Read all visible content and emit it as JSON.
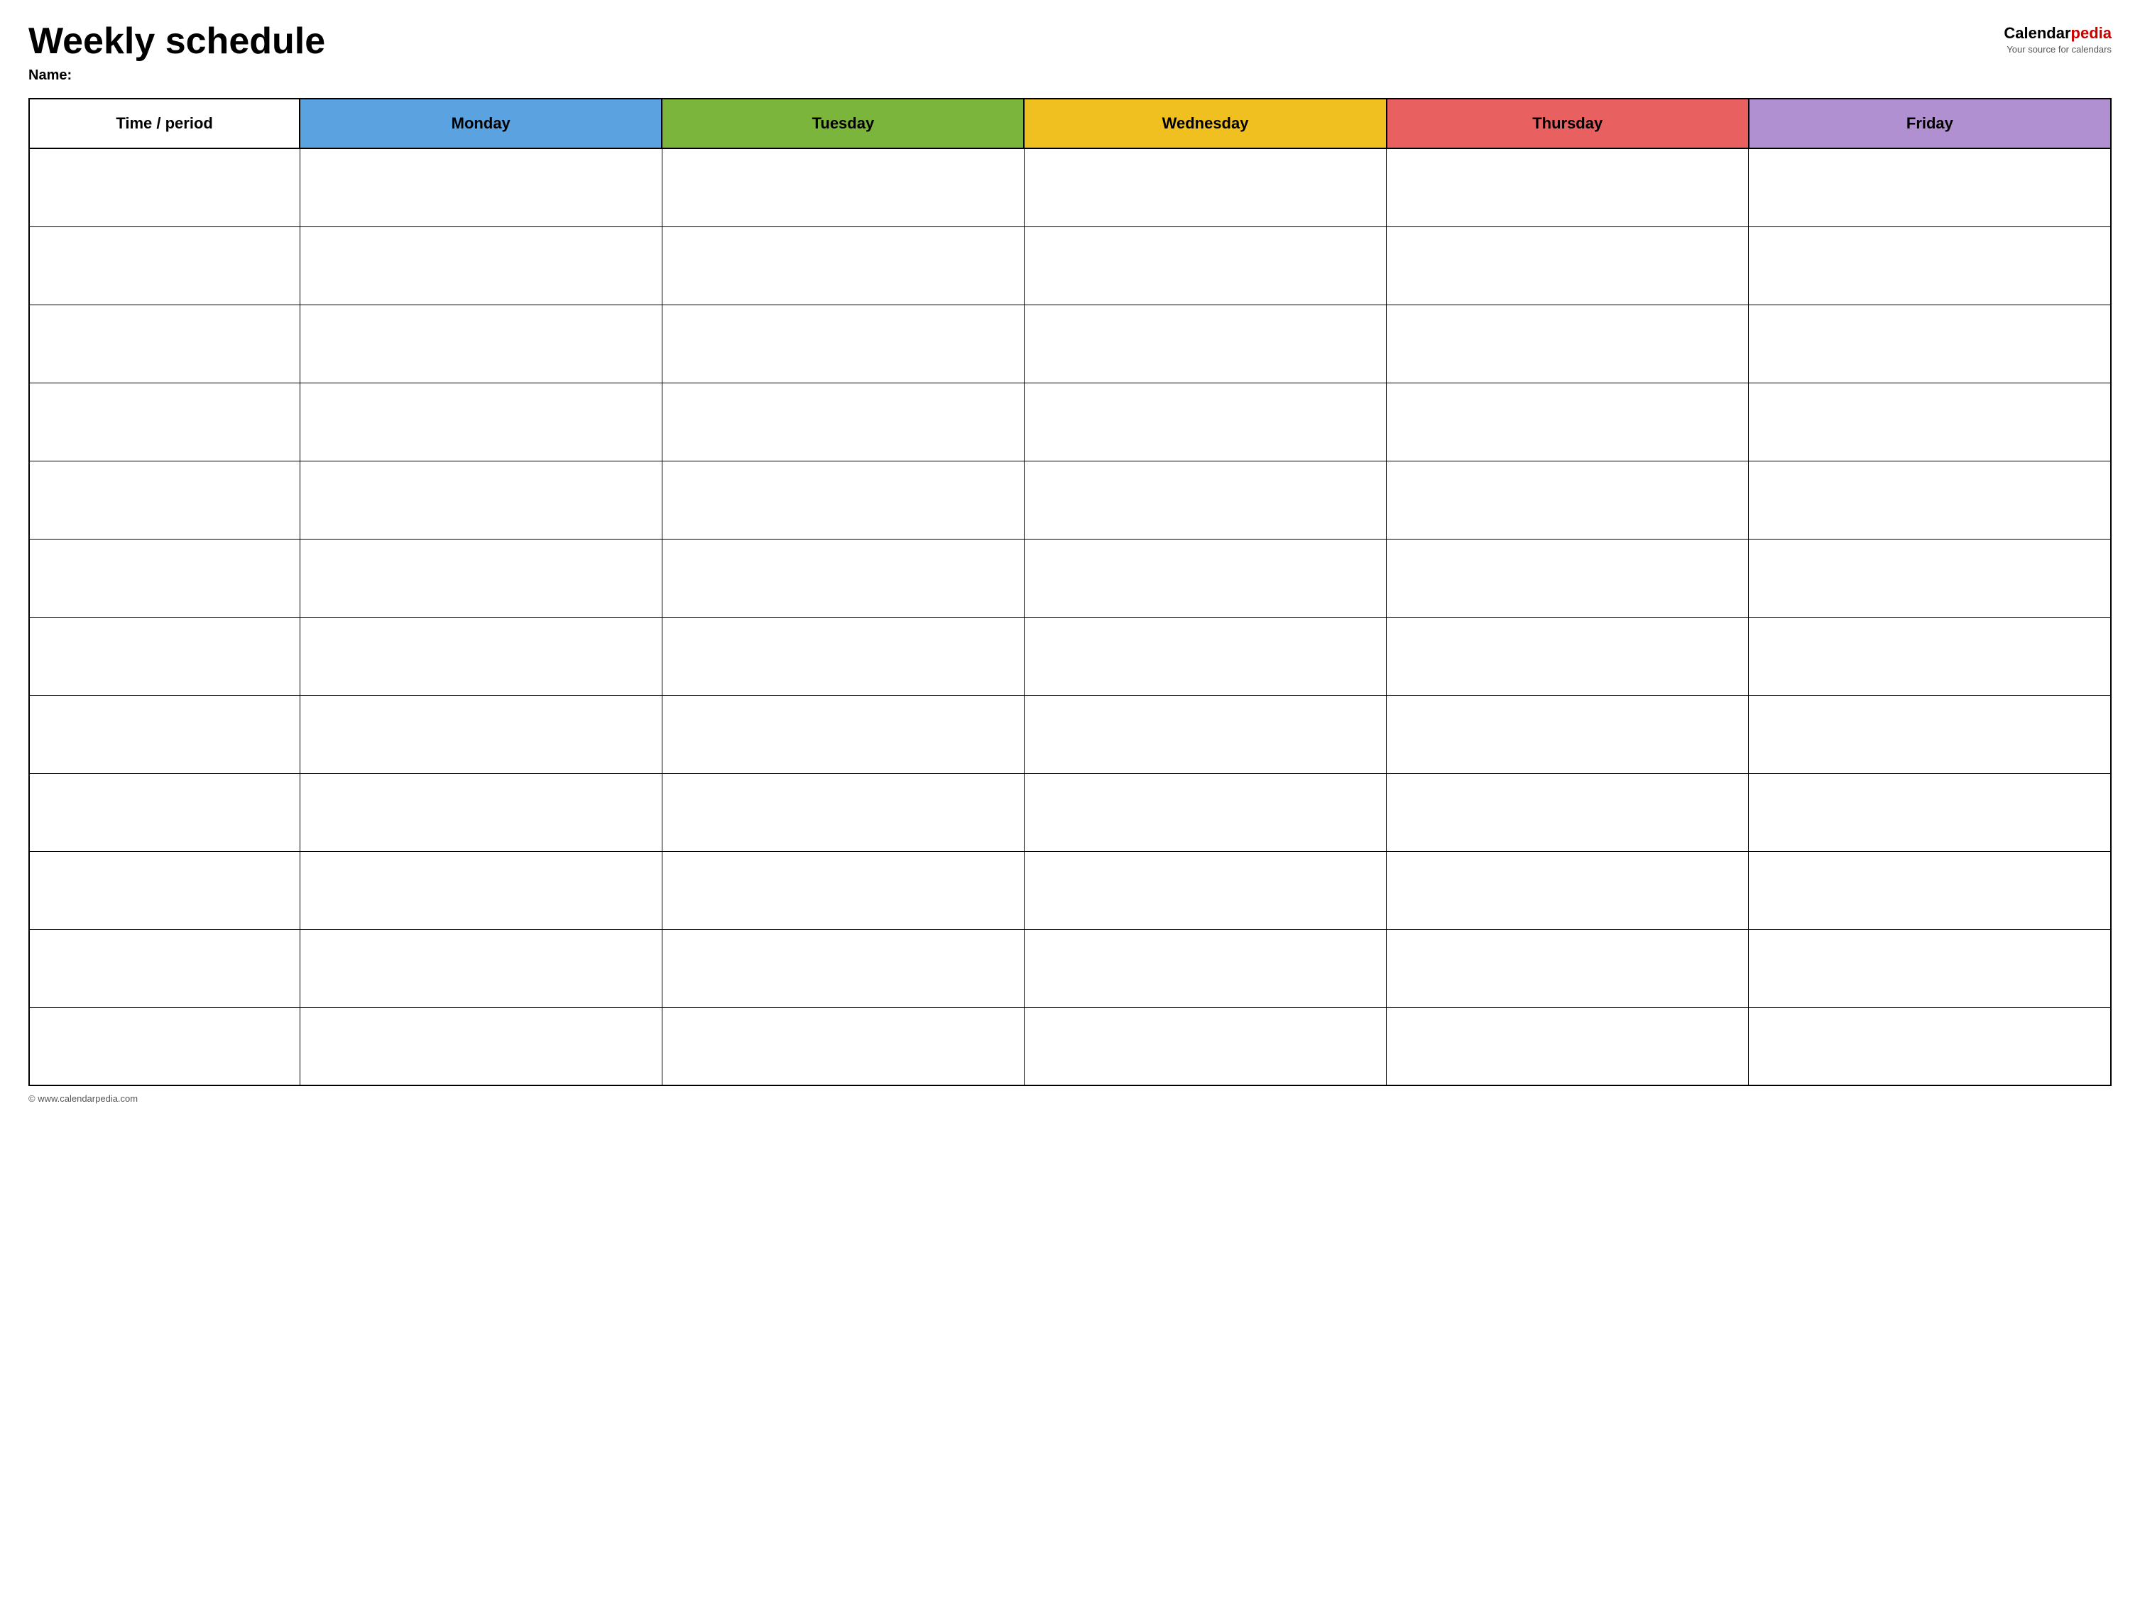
{
  "header": {
    "title": "Weekly schedule",
    "name_label": "Name:",
    "logo": {
      "brand_calendar": "Calendar",
      "brand_pedia": "pedia",
      "tagline": "Your source for calendars"
    }
  },
  "table": {
    "columns": [
      {
        "id": "time",
        "label": "Time / period",
        "color": "#ffffff"
      },
      {
        "id": "monday",
        "label": "Monday",
        "color": "#5ba3e0"
      },
      {
        "id": "tuesday",
        "label": "Tuesday",
        "color": "#7cb53c"
      },
      {
        "id": "wednesday",
        "label": "Wednesday",
        "color": "#f0c020"
      },
      {
        "id": "thursday",
        "label": "Thursday",
        "color": "#e86060"
      },
      {
        "id": "friday",
        "label": "Friday",
        "color": "#b090d0"
      }
    ],
    "row_count": 12
  },
  "footer": {
    "url": "© www.calendarpedia.com"
  }
}
